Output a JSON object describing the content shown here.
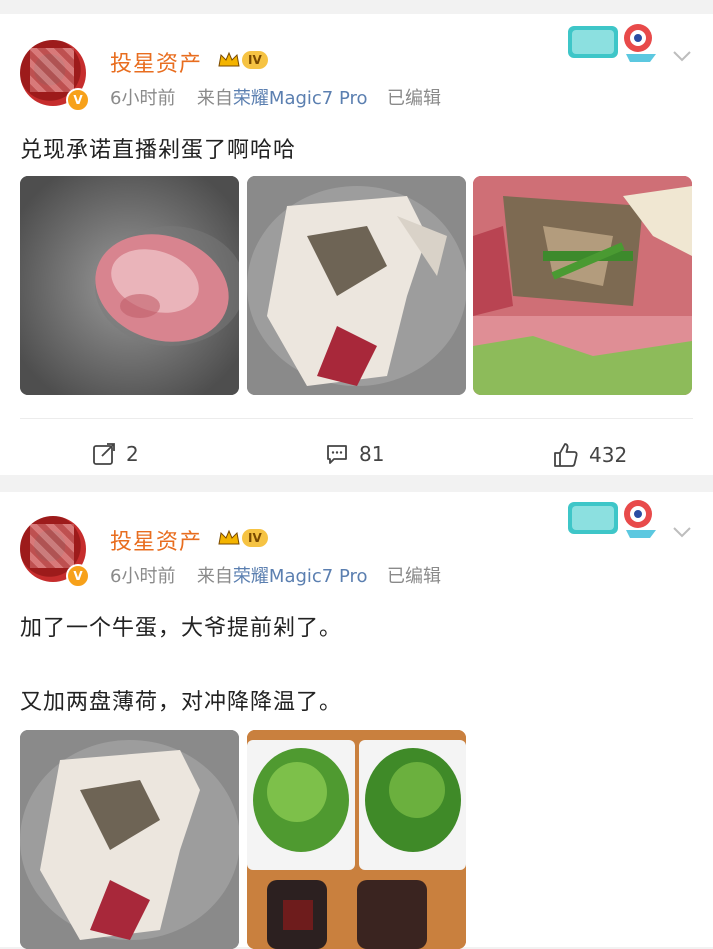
{
  "posts": [
    {
      "author": "投星资产",
      "level_badge": "IV",
      "time": "6小时前",
      "source_prefix": "来自",
      "device": "荣耀Magic7 Pro",
      "edited": "已编辑",
      "lines": [
        "兑现承诺直播剁蛋了啊哈哈"
      ],
      "actions": {
        "repost": "2",
        "comment": "81",
        "like": "432"
      }
    },
    {
      "author": "投星资产",
      "level_badge": "IV",
      "time": "6小时前",
      "source_prefix": "来自",
      "device": "荣耀Magic7 Pro",
      "edited": "已编辑",
      "lines": [
        "加了一个牛蛋，大爷提前剁了。",
        "又加两盘薄荷，对冲降降温了。"
      ]
    }
  ],
  "icons": {
    "repost": "share-icon",
    "comment": "comment-icon",
    "like": "like-icon",
    "verified": "verified-badge-icon",
    "crown": "crown-icon",
    "menu": "chevron-down-icon"
  },
  "colors": {
    "author": "#e86d1f",
    "device": "#5b7fb0",
    "meta": "#8a8a8a",
    "badge": "#f7a11a"
  }
}
